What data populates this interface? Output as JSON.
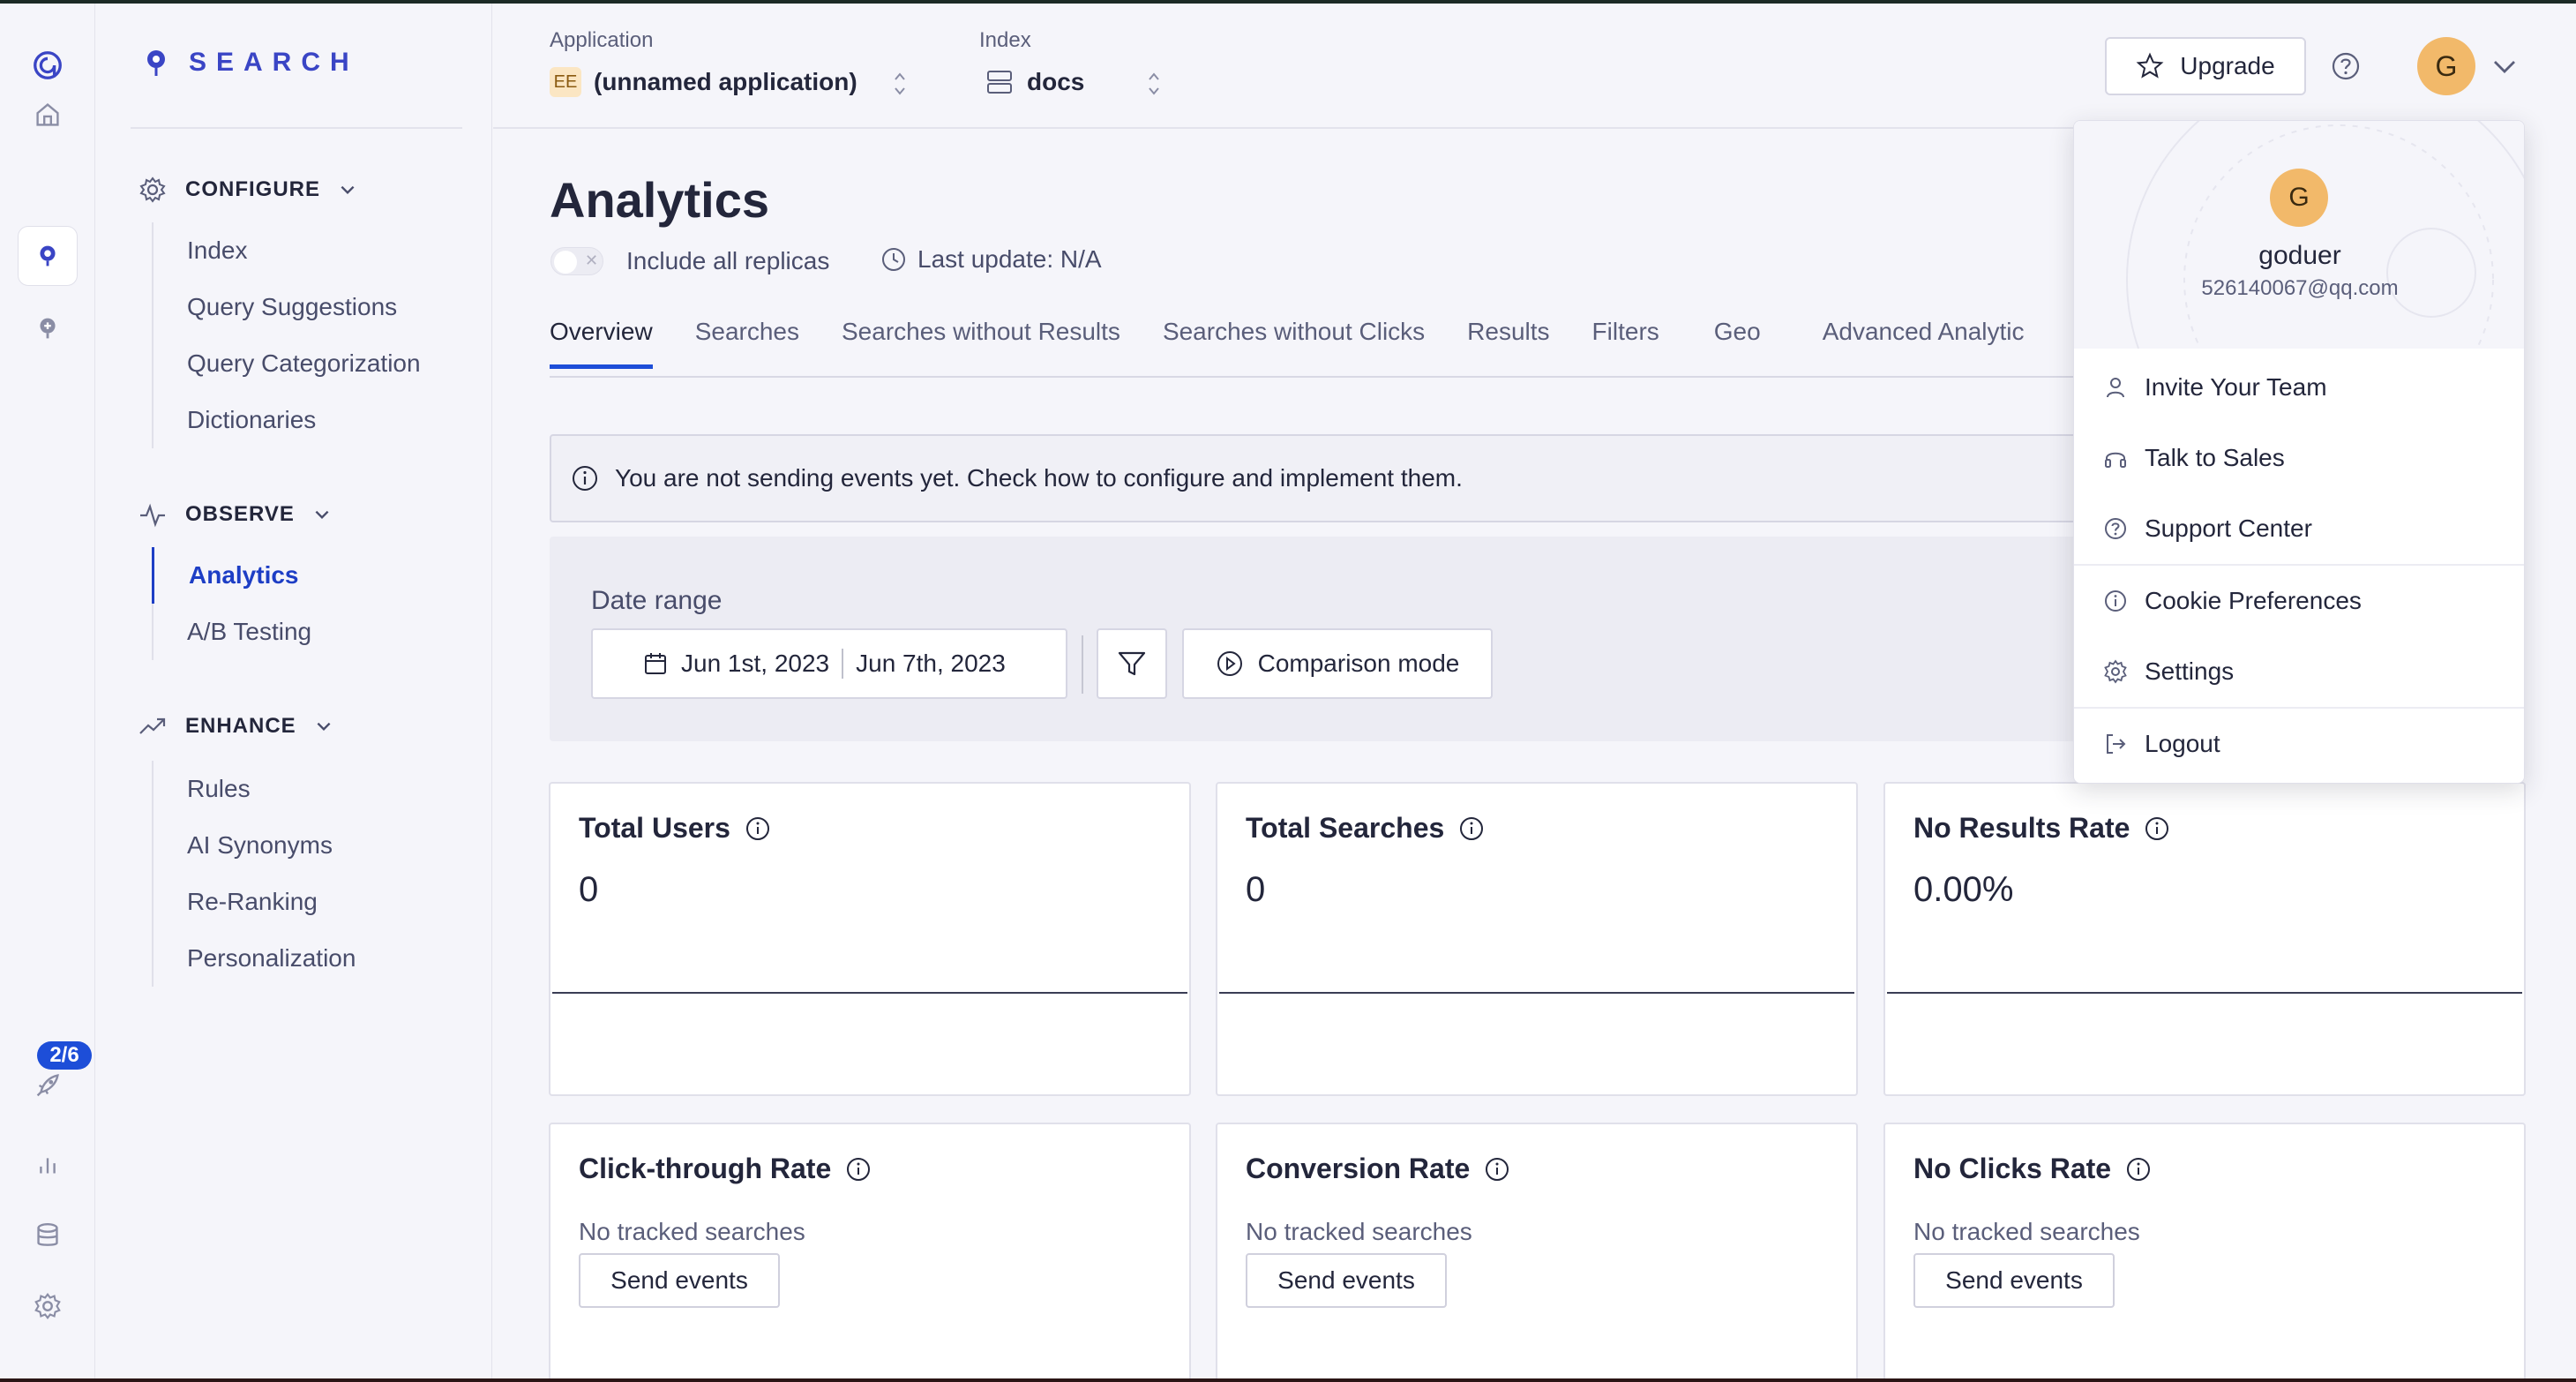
{
  "brand": {
    "name": "SEARCH"
  },
  "rail": {
    "onboarding_badge": "2/6"
  },
  "sidebar": {
    "sections": [
      {
        "title": "CONFIGURE",
        "items": [
          "Index",
          "Query Suggestions",
          "Query Categorization",
          "Dictionaries"
        ]
      },
      {
        "title": "OBSERVE",
        "items": [
          "Analytics",
          "A/B Testing"
        ]
      },
      {
        "title": "ENHANCE",
        "items": [
          "Rules",
          "AI Synonyms",
          "Re-Ranking",
          "Personalization"
        ]
      }
    ],
    "active_item": "Analytics"
  },
  "header": {
    "application_label": "Application",
    "application_badge": "EE",
    "application_value": "(unnamed application)",
    "index_label": "Index",
    "index_value": "docs",
    "upgrade_label": "Upgrade",
    "avatar_initial": "G"
  },
  "page": {
    "title": "Analytics",
    "replicas_label": "Include all replicas",
    "last_update": "Last update: N/A",
    "tabs": [
      "Overview",
      "Searches",
      "Searches without Results",
      "Searches without Clicks",
      "Results",
      "Filters",
      "Geo",
      "Advanced Analytic"
    ],
    "active_tab": "Overview",
    "notice": "You are not sending events yet. Check how to configure and implement them."
  },
  "date_range": {
    "label": "Date range",
    "start": "Jun 1st, 2023",
    "end": "Jun 7th, 2023",
    "comparison_label": "Comparison mode"
  },
  "metrics": [
    {
      "title": "Total Users",
      "value": "0"
    },
    {
      "title": "Total Searches",
      "value": "0"
    },
    {
      "title": "No Results Rate",
      "value": "0.00%"
    }
  ],
  "rates": [
    {
      "title": "Click-through Rate",
      "empty": "No tracked searches",
      "button": "Send events"
    },
    {
      "title": "Conversion Rate",
      "empty": "No tracked searches",
      "button": "Send events"
    },
    {
      "title": "No Clicks Rate",
      "empty": "No tracked searches",
      "button": "Send events"
    }
  ],
  "user_menu": {
    "initial": "G",
    "username": "goduer",
    "email": "526140067@qq.com",
    "items": [
      "Invite Your Team",
      "Talk to Sales",
      "Support Center",
      "Cookie Preferences",
      "Settings",
      "Logout"
    ]
  },
  "colors": {
    "accent": "#1d4ed8",
    "brand": "#3a45c5",
    "avatar": "#f2b96a"
  }
}
